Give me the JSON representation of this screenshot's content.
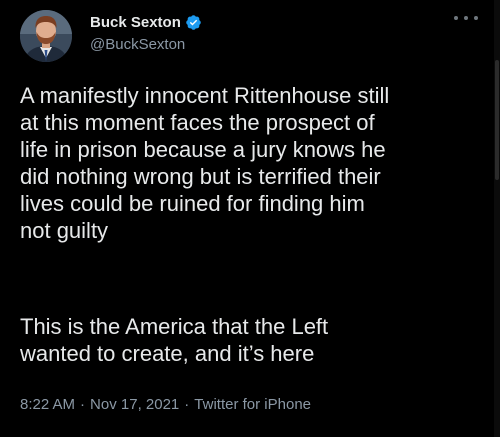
{
  "author": {
    "display_name": "Buck Sexton",
    "handle": "@BuckSexton",
    "verified": true,
    "avatar_icon": "profile-photo"
  },
  "tweet": {
    "paragraph1": "A manifestly innocent Rittenhouse still\nat this moment faces the prospect of\nlife in prison because a jury knows he\ndid nothing wrong but is terrified their\nlives could be ruined for finding him\nnot guilty",
    "paragraph2": "This is the America that the Left\nwanted to create, and it’s here",
    "time": "8:22 AM",
    "date": "Nov 17, 2021",
    "source": "Twitter for iPhone",
    "separator": "·"
  },
  "icons": {
    "more": "more-horizontal-icon",
    "verified": "verified-badge-icon"
  },
  "colors": {
    "background": "#000000",
    "primary_text": "#e7e9ea",
    "secondary_text": "#8b98a5",
    "verified_blue": "#1d9bf0"
  }
}
